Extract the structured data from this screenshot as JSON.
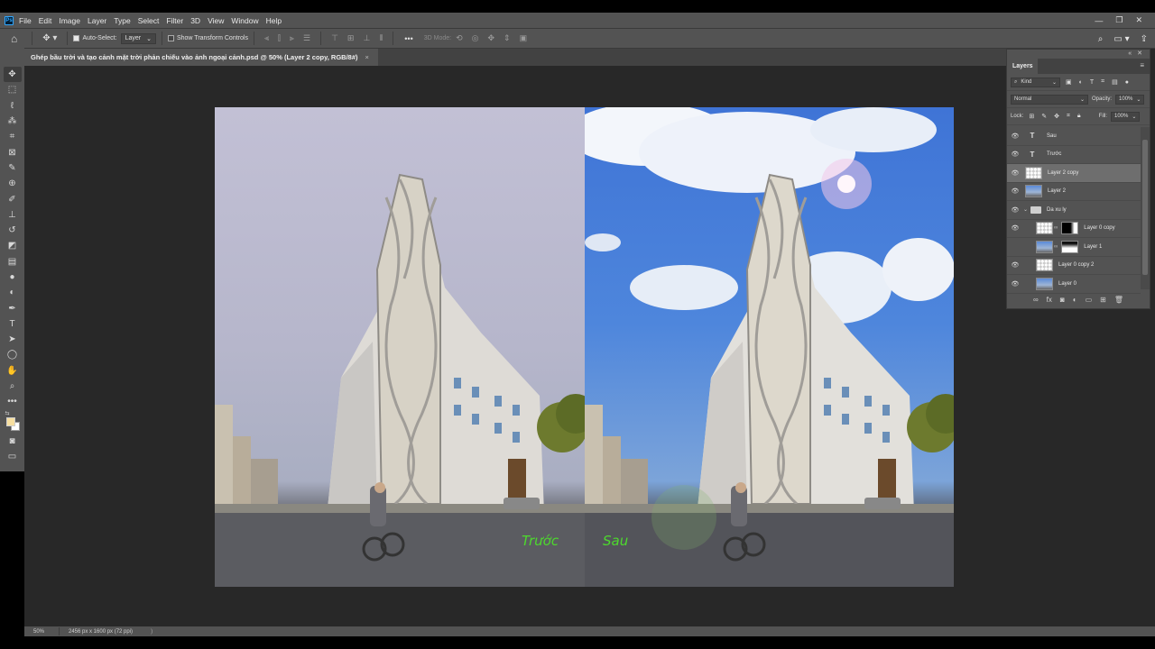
{
  "app": {
    "logo": "Ps",
    "menus": [
      "File",
      "Edit",
      "Image",
      "Layer",
      "Type",
      "Select",
      "Filter",
      "3D",
      "View",
      "Window",
      "Help"
    ],
    "window_controls": [
      "—",
      "❐",
      "✕"
    ]
  },
  "options_bar": {
    "auto_select_label": "Auto-Select:",
    "auto_select_checked": true,
    "auto_select_target": "Layer",
    "show_transform_label": "Show Transform Controls",
    "show_transform_checked": false,
    "more_label": "•••",
    "mode_3d_label": "3D Mode:"
  },
  "document": {
    "tab_title": "Ghép bầu trời và tạo cảnh mặt trời phản chiếu vào ảnh ngoại cảnh.psd @ 50% (Layer 2 copy, RGB/8#)",
    "close": "×",
    "label_before": "Trước",
    "label_after": "Sau"
  },
  "status_bar": {
    "zoom": "50%",
    "doc_info": "2456 px x 1600 px (72 ppi)",
    "arrow": ")"
  },
  "colors": {
    "foreground": "#f7dfa0",
    "background": "#ffffff",
    "label_green": "#4dd92d"
  },
  "layers_panel": {
    "tab": "Layers",
    "filter_kind": "Kind",
    "blend_mode": "Normal",
    "opacity_label": "Opacity:",
    "opacity_value": "100%",
    "lock_label": "Lock:",
    "fill_label": "Fill:",
    "fill_value": "100%",
    "layers": [
      {
        "name": "Sau",
        "type": "text",
        "visible": true,
        "selected": false,
        "indent": false
      },
      {
        "name": "Trước",
        "type": "text",
        "visible": true,
        "selected": false,
        "indent": false
      },
      {
        "name": "Layer 2 copy",
        "type": "pixel",
        "visible": true,
        "selected": true,
        "indent": false
      },
      {
        "name": "Layer 2",
        "type": "pixel",
        "visible": true,
        "selected": false,
        "indent": false
      },
      {
        "name": "Da xu ly",
        "type": "group",
        "visible": true,
        "selected": false,
        "indent": false
      },
      {
        "name": "Layer 0 copy",
        "type": "masked",
        "visible": true,
        "selected": false,
        "indent": true
      },
      {
        "name": "Layer 1",
        "type": "masked-photo",
        "visible": false,
        "selected": false,
        "indent": true
      },
      {
        "name": "Layer 0 copy 2",
        "type": "pixel",
        "visible": true,
        "selected": false,
        "indent": true
      },
      {
        "name": "Layer 0",
        "type": "pixel",
        "visible": true,
        "selected": false,
        "indent": true
      }
    ]
  },
  "icons": {
    "tools": [
      "move-icon",
      "marquee-icon",
      "lasso-icon",
      "magic-wand-icon",
      "crop-icon",
      "frame-icon",
      "eyedropper-icon",
      "healing-icon",
      "brush-icon",
      "stamp-icon",
      "history-brush-icon",
      "eraser-icon",
      "gradient-icon",
      "blur-icon",
      "dodge-icon",
      "pen-icon",
      "type-icon",
      "path-select-icon",
      "ellipse-icon",
      "hand-icon",
      "zoom-icon",
      "more-tools-icon"
    ]
  }
}
